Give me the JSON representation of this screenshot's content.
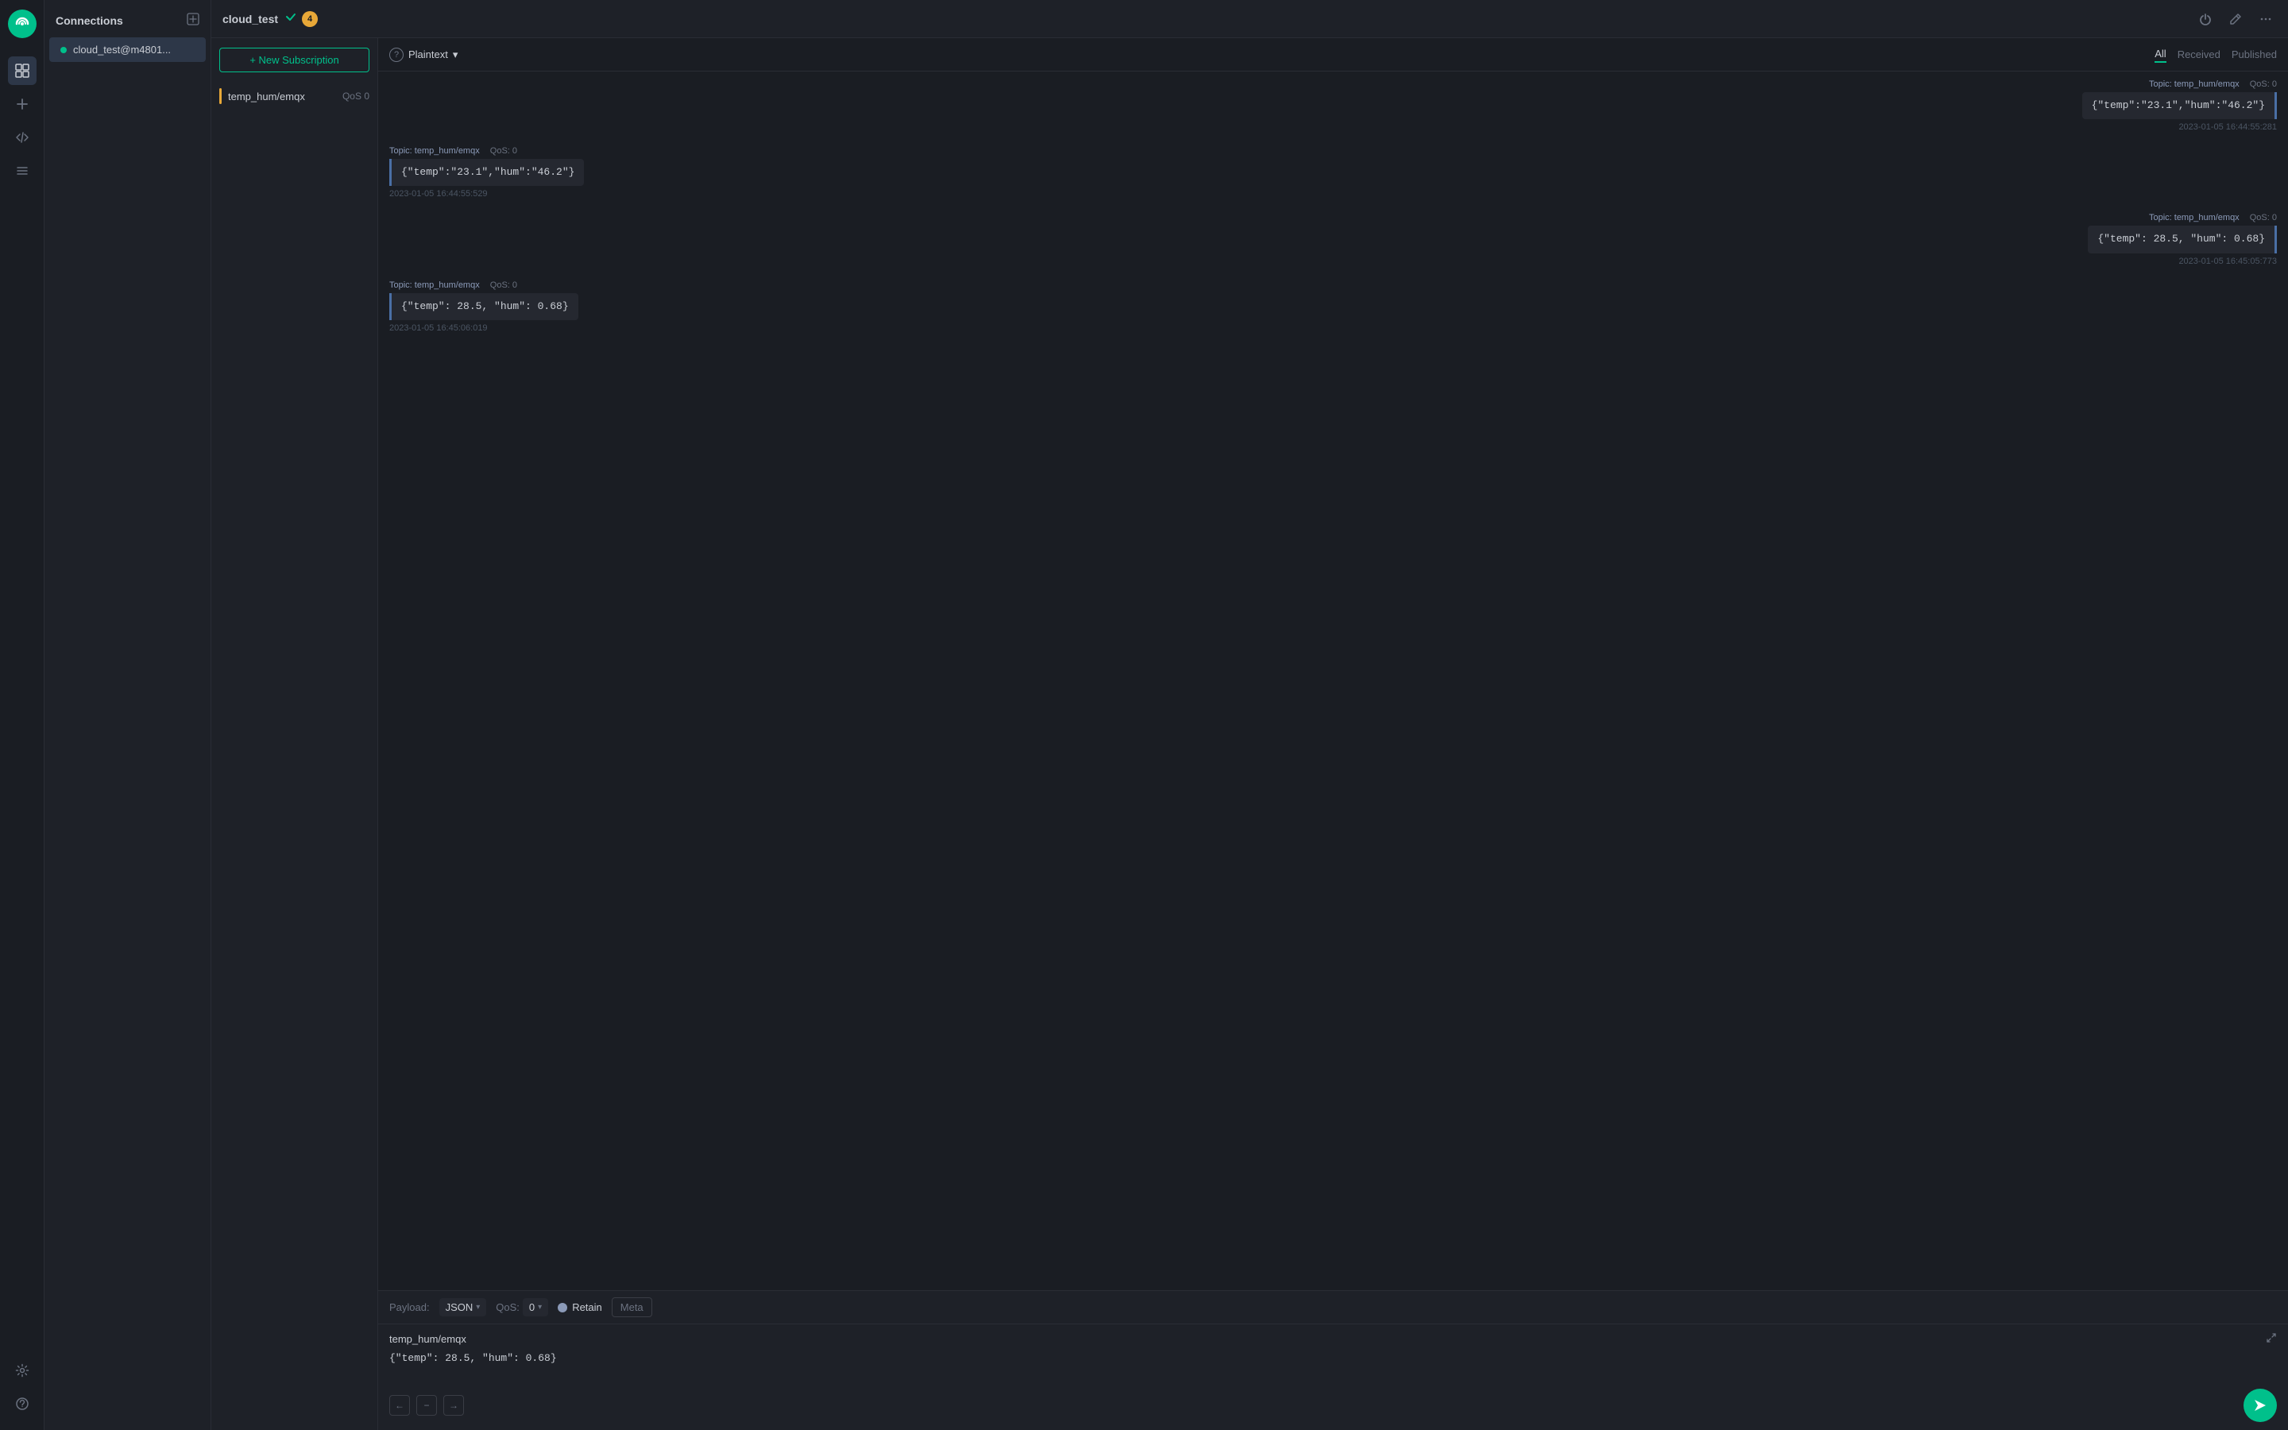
{
  "app": {
    "logo_char": "✕",
    "logo_bg": "#00c08b"
  },
  "iconbar": {
    "connections_icon": "⊞",
    "add_icon": "+",
    "code_icon": "</>",
    "list_icon": "☰",
    "settings_icon": "⚙",
    "help_icon": "?"
  },
  "sidebar": {
    "title": "Connections",
    "add_btn_label": "+",
    "connections": [
      {
        "name": "cloud_test@m4801...",
        "status": "connected"
      }
    ]
  },
  "topbar": {
    "title": "cloud_test",
    "check_icon": "✓",
    "badge_count": "4",
    "power_icon": "⏻",
    "edit_icon": "✎",
    "more_icon": "⋯"
  },
  "sub_panel": {
    "new_sub_btn": "+ New Subscription",
    "subscriptions": [
      {
        "topic": "temp_hum/emqx",
        "qos_label": "QoS 0"
      }
    ]
  },
  "messages_header": {
    "format_label": "Plaintext",
    "format_chevron": "▾",
    "help_char": "?",
    "tabs": [
      {
        "label": "All",
        "active": true
      },
      {
        "label": "Received",
        "active": false
      },
      {
        "label": "Published",
        "active": false
      }
    ]
  },
  "messages": [
    {
      "direction": "published",
      "topic": "Topic: temp_hum/emqx",
      "qos": "QoS: 0",
      "content": "{\"temp\":\"23.1\",\"hum\":\"46.2\"}",
      "timestamp": "2023-01-05 16:44:55:281"
    },
    {
      "direction": "received",
      "topic": "Topic: temp_hum/emqx",
      "qos": "QoS: 0",
      "content": "{\"temp\":\"23.1\",\"hum\":\"46.2\"}",
      "timestamp": "2023-01-05 16:44:55:529"
    },
    {
      "direction": "published",
      "topic": "Topic: temp_hum/emqx",
      "qos": "QoS: 0",
      "content": "{\"temp\": 28.5, \"hum\": 0.68}",
      "timestamp": "2023-01-05 16:45:05:773"
    },
    {
      "direction": "received",
      "topic": "Topic: temp_hum/emqx",
      "qos": "QoS: 0",
      "content": "{\"temp\": 28.5, \"hum\": 0.68}",
      "timestamp": "2023-01-05 16:45:06:019"
    }
  ],
  "publish_bar": {
    "payload_label": "Payload:",
    "payload_format": "JSON",
    "qos_label": "QoS:",
    "qos_value": "0",
    "retain_label": "Retain",
    "meta_btn": "Meta",
    "topic_value": "temp_hum/emqx",
    "payload_value": "{\"temp\": 28.5, \"hum\": 0.68}",
    "prev_icon": "←",
    "minus_icon": "−",
    "next_icon": "→",
    "send_icon": "➤"
  }
}
